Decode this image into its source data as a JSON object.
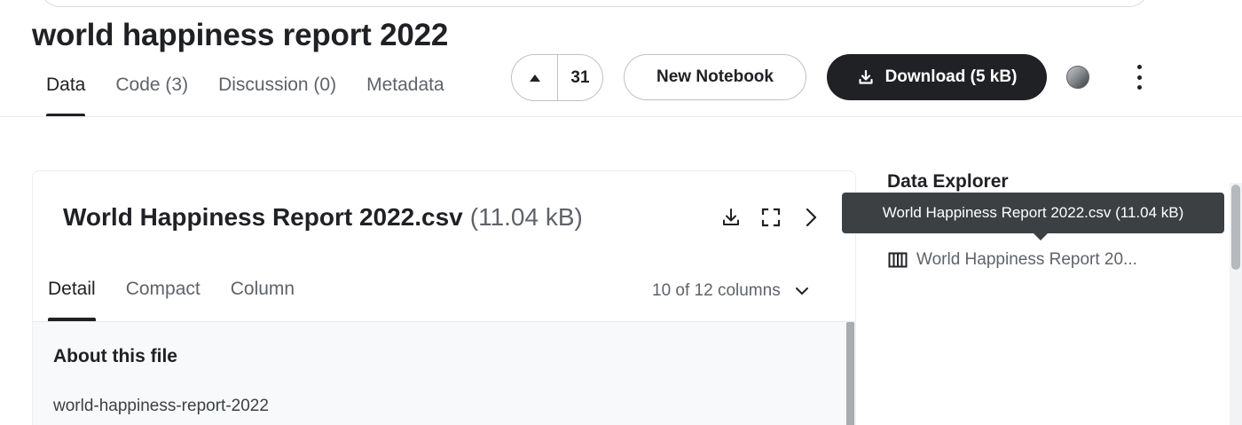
{
  "dataset": {
    "title": "world happiness report 2022"
  },
  "tabs": [
    {
      "label": "Data",
      "active": true
    },
    {
      "label": "Code (3)",
      "active": false
    },
    {
      "label": "Discussion (0)",
      "active": false
    },
    {
      "label": "Metadata",
      "active": false
    }
  ],
  "actions": {
    "upvote_count": "31",
    "new_notebook_label": "New Notebook",
    "download_label": "Download (5 kB)"
  },
  "file_card": {
    "file_name": "World Happiness Report 2022.csv",
    "file_size": "(11.04 kB)",
    "tabs": [
      {
        "label": "Detail",
        "active": true
      },
      {
        "label": "Compact",
        "active": false
      },
      {
        "label": "Column",
        "active": false
      }
    ],
    "columns_selector": "10 of 12 columns",
    "about_title": "About this file",
    "about_description": "world-happiness-report-2022"
  },
  "data_explorer": {
    "title": "Data Explorer",
    "items": [
      {
        "label": "World Happiness Report 20..."
      }
    ],
    "tooltip": "World Happiness Report 2022.csv (11.04 kB)"
  },
  "icons": {
    "upvote": "triangle-up-icon",
    "download": "download-icon",
    "expand": "fullscreen-icon",
    "next": "chevron-right-icon",
    "columns_dropdown": "chevron-down-icon",
    "table": "table-columns-icon",
    "more": "more-vertical-icon"
  },
  "colors": {
    "primary_dark": "#202124",
    "secondary_text": "#5f6368",
    "tooltip_bg": "#3c4043",
    "panel_bg": "#f8f9fa"
  }
}
